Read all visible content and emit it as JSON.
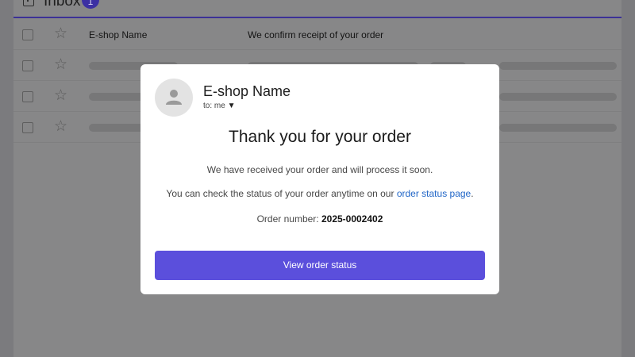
{
  "inbox": {
    "title": "Inbox",
    "unread_count": "1",
    "rows": [
      {
        "sender": "E-shop Name",
        "subject": "We confirm receipt of your order"
      }
    ]
  },
  "email": {
    "sender": "E-shop Name",
    "to_label": "to: me",
    "to_caret": "▼",
    "heading": "Thank you for your order",
    "line1": "We have received your order and will process it soon.",
    "line2_prefix": "You can check the status of your order anytime on our",
    "line2_link": "order status page",
    "line2_suffix": ".",
    "order_label": "Order number:",
    "order_number": "2025-0002402",
    "cta_label": "View order status"
  },
  "colors": {
    "accent": "#5b4fdc",
    "link": "#2166c7",
    "overlay": "#7b7b7e"
  }
}
